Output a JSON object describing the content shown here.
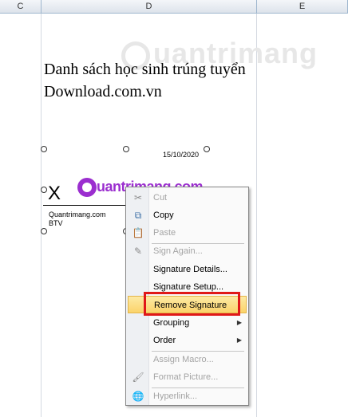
{
  "columns": [
    "C",
    "D",
    "E"
  ],
  "title_lines": [
    "Danh sách học sinh trúng tuyển",
    "Download.com.vn"
  ],
  "watermark": "uantrimang",
  "signature": {
    "mark": "X",
    "date": "15/10/2020",
    "name": "Quantrimang.com",
    "title": "BTV"
  },
  "logo_text": "uantrimang.com",
  "context_menu": {
    "items": [
      {
        "label": "Cut",
        "enabled": false,
        "icon": "scissors-icon"
      },
      {
        "label": "Copy",
        "enabled": true,
        "icon": "copy-icon"
      },
      {
        "label": "Paste",
        "enabled": false,
        "icon": "paste-icon"
      },
      {
        "label": "Sign Again...",
        "enabled": false,
        "icon": "sign-icon"
      },
      {
        "label": "Signature Details...",
        "enabled": true
      },
      {
        "label": "Signature Setup...",
        "enabled": true
      },
      {
        "label": "Remove Signature",
        "enabled": true,
        "highlighted": true
      },
      {
        "label": "Grouping",
        "enabled": true,
        "submenu": true
      },
      {
        "label": "Order",
        "enabled": true,
        "submenu": true
      },
      {
        "label": "Assign Macro...",
        "enabled": false
      },
      {
        "label": "Format Picture...",
        "enabled": false,
        "icon": "format-picture-icon"
      },
      {
        "label": "Hyperlink...",
        "enabled": false,
        "icon": "hyperlink-icon"
      }
    ]
  }
}
